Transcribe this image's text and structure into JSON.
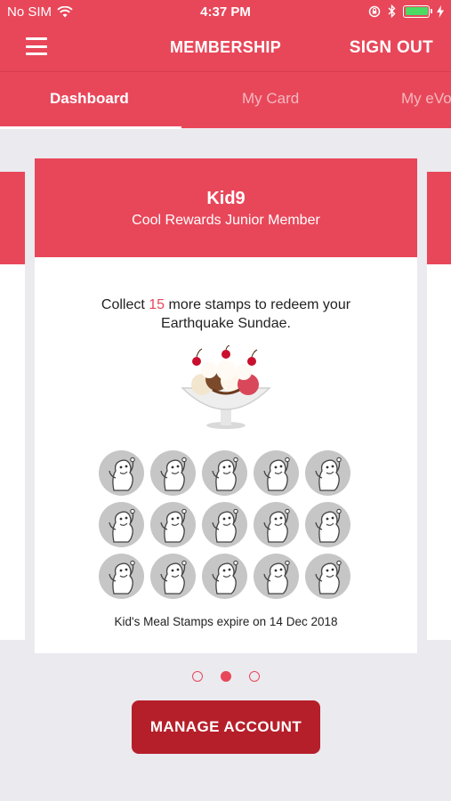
{
  "status_bar": {
    "carrier": "No SIM",
    "time": "4:37 PM",
    "icons": [
      "wifi-icon",
      "orientation-lock-icon",
      "bluetooth-icon",
      "battery-icon",
      "charging-icon"
    ]
  },
  "navbar": {
    "title": "MEMBERSHIP",
    "sign_out_label": "SIGN OUT",
    "menu_icon": "hamburger-menu-icon"
  },
  "tabs": [
    {
      "label": "Dashboard",
      "active": true
    },
    {
      "label": "My Card",
      "active": false
    },
    {
      "label": "My eVo",
      "active": false
    }
  ],
  "card": {
    "name": "Kid9",
    "subtitle": "Cool Rewards Junior Member",
    "collect_prefix": "Collect",
    "stamps_remaining": "15",
    "collect_suffix": "more stamps to redeem your",
    "reward": "Earthquake Sundae.",
    "reward_image": "sundae-image",
    "stamp_total": 15,
    "stamp_icon": "mascot-stamp-icon",
    "expiry_text": "Kid's Meal Stamps expire on 14 Dec 2018"
  },
  "pagination": {
    "count": 3,
    "active_index": 1
  },
  "manage_account_label": "MANAGE ACCOUNT",
  "colors": {
    "brand_red": "#e8475a",
    "button_dark_red": "#b51f2a",
    "background": "#ebeaef",
    "stamp_gray": "#c6c6c6"
  }
}
